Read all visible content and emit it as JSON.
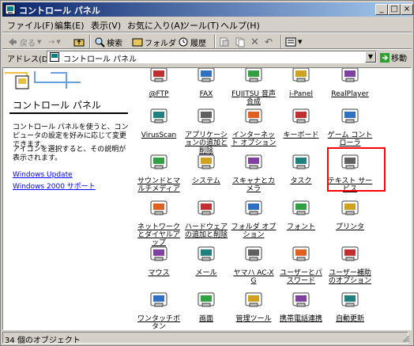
{
  "window": {
    "title": "コントロール パネル"
  },
  "title_buttons": {
    "minimize": "_",
    "maximize": "□",
    "close": "×"
  },
  "menu": [
    "ファイル(F)",
    "編集(E)",
    "表示(V)",
    "お気に入り(A)",
    "ツール(T)",
    "ヘルプ(H)"
  ],
  "toolbar": {
    "back": "戻る",
    "forward": "→",
    "search": "検索",
    "folders": "フォルダ",
    "history": "履歴"
  },
  "address": {
    "label": "アドレス(D)",
    "value": "コントロール パネル",
    "go": "移動"
  },
  "left_panel": {
    "title": "コントロール パネル",
    "desc1": "コントロール パネルを使うと、コンピュータの設定を好みに応じて変更できます。",
    "desc2": "アイコンを選択すると、その説明が表示されます。",
    "links": [
      "Windows Update",
      "Windows 2000 サポート"
    ]
  },
  "icons": [
    {
      "label": "@FTP",
      "icon": "ftp-icon"
    },
    {
      "label": "FAX",
      "icon": "fax-icon"
    },
    {
      "label": "FUJITSU 音声合成",
      "icon": "speech-icon"
    },
    {
      "label": "i-Panel",
      "icon": "ipanel-icon"
    },
    {
      "label": "RealPlayer",
      "icon": "realplayer-icon"
    },
    {
      "label": "VirusScan",
      "icon": "virusscan-icon"
    },
    {
      "label": "アプリケーションの追加と削除",
      "icon": "add-remove-programs-icon"
    },
    {
      "label": "インターネット オプション",
      "icon": "internet-options-icon"
    },
    {
      "label": "キーボード",
      "icon": "keyboard-icon"
    },
    {
      "label": "ゲーム コントローラ",
      "icon": "game-controller-icon"
    },
    {
      "label": "サウンドとマルチメディア",
      "icon": "sound-icon"
    },
    {
      "label": "システム",
      "icon": "system-icon"
    },
    {
      "label": "スキャナとカメラ",
      "icon": "scanner-camera-icon"
    },
    {
      "label": "タスク",
      "icon": "tasks-icon"
    },
    {
      "label": "テキスト サービス",
      "icon": "text-services-icon"
    },
    {
      "label": "ネットワークとダイヤルアップ",
      "icon": "network-icon"
    },
    {
      "label": "ハードウェアの追加と削除",
      "icon": "add-hardware-icon"
    },
    {
      "label": "フォルダ オプション",
      "icon": "folder-options-icon"
    },
    {
      "label": "フォント",
      "icon": "fonts-icon"
    },
    {
      "label": "プリンタ",
      "icon": "printers-icon"
    },
    {
      "label": "マウス",
      "icon": "mouse-icon"
    },
    {
      "label": "メール",
      "icon": "mail-icon"
    },
    {
      "label": "ヤマハ AC-XG",
      "icon": "yamaha-icon"
    },
    {
      "label": "ユーザーとパスワード",
      "icon": "users-passwords-icon"
    },
    {
      "label": "ユーザー補助のオプション",
      "icon": "accessibility-icon"
    },
    {
      "label": "ワンタッチボタン",
      "icon": "onetouch-button-icon"
    },
    {
      "label": "画面",
      "icon": "display-icon"
    },
    {
      "label": "管理ツール",
      "icon": "admin-tools-icon"
    },
    {
      "label": "携帯電話連携",
      "icon": "mobile-phone-icon"
    },
    {
      "label": "自動更新",
      "icon": "auto-update-icon"
    }
  ],
  "status": {
    "text": "34 個のオブジェクト"
  }
}
